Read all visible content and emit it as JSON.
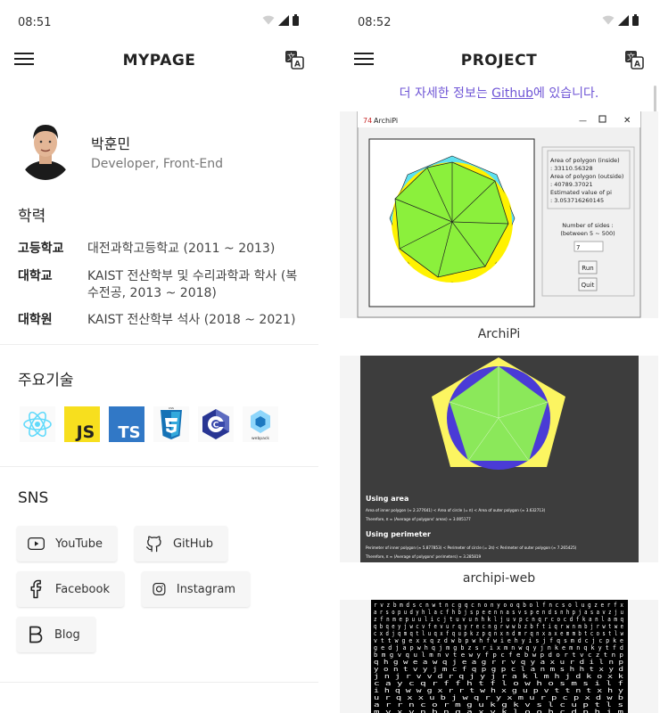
{
  "left": {
    "status_time": "08:51",
    "appbar_title": "MYPAGE",
    "profile": {
      "name": "박훈민",
      "role": "Developer, Front-End"
    },
    "education": {
      "title": "학력",
      "rows": [
        {
          "label": "고등학교",
          "value": "대전과학고등학교 (2011 ~ 2013)"
        },
        {
          "label": "대학교",
          "value": "KAIST 전산학부 및 수리과학과 학사 (복수전공, 2013 ~ 2018)"
        },
        {
          "label": "대학원",
          "value": "KAIST 전산학부 석사 (2018 ~ 2021)"
        }
      ]
    },
    "skills": {
      "title": "주요기술",
      "items": [
        "react-icon",
        "javascript-icon",
        "typescript-icon",
        "css3-icon",
        "c-icon",
        "webpack-icon"
      ],
      "js_label": "JS",
      "ts_label": "TS",
      "css_label": "CSS",
      "c_label": "C",
      "webpack_label": "webpack"
    },
    "sns": {
      "title": "SNS",
      "buttons": {
        "youtube": "YouTube",
        "github": "GitHub",
        "facebook": "Facebook",
        "instagram": "Instagram",
        "blog": "Blog"
      }
    }
  },
  "right": {
    "status_time": "08:52",
    "appbar_title": "PROJECT",
    "info_prefix": "더 자세한 정보는 ",
    "info_link": "Github",
    "info_suffix": "에 있습니다.",
    "projects": [
      {
        "caption": "ArchiPi",
        "window_title": "ArchiPi",
        "panel_lines": [
          "Area of polygon (inside)",
          ": 33110.56328",
          "Area of polygon (outside)",
          ": 40789.37021",
          "Estimated value of pi",
          ": 3.053716260145"
        ],
        "sides_label": "Number of sides :",
        "sides_range": "(between 5 ~ 500)",
        "sides_value": "7",
        "run_label": "Run",
        "quit_label": "Quit"
      },
      {
        "caption": "archipi-web",
        "area_heading": "Using area",
        "area_line1": "Area of inner polygon (≈ 2.377641) < Area of circle (= π) < Area of outer polygon (≈ 3.632713)",
        "area_line2": "Therefore, π ≈ (Average of polygons' areas) ≈ 3.005177",
        "perim_heading": "Using perimeter",
        "perim_line1": "Perimeter of inner polygon (≈ 5.877853) < Perimeter of circle (= 2π) < Perimeter of outer polygon (≈ 7.265425)",
        "perim_line2": "Therefore, π ≈ (Average of polygons' perimeters) ≈ 3.285819"
      },
      {
        "caption": "",
        "matrix_lines": [
          "r v z b m d s c n w t n c g q c n o n y o o q b o l f n c s o l u g z e r f x",
          "a r s o p u d y h l a c f h b j s p e e n n a s v s p e n d s n h p j a s a v z j u",
          "z f n m e p u u l i c j t u v u n h k l j u v p c n q r c o c d f k a n l a m q",
          "q b q e y j w c v f e v u r q y r e c n g r w w b z b f t i q r w n m b j r w t w e",
          "c x d j q m q t l u q x f q u p k z p q n x n d m r q n x a x e m m b t c o s t l w",
          "v t t w g e x x q z d w b p w h f w i e h y i s j f q s m d c   j c p   k e",
          "g e d j a p w h q j m g b z s r i x m n w q y j n k e m n q k y           t f d",
          "b m g v q u l m n v t e w y f p c f e b w p d o r t v c z               t n p",
          "q h g w e a w q j e a g r r v q y a x u r d i                             l n p",
          "y o n t v y j m c f q p g p c l a n m s h h t                             x y d",
          "j n j r v v d r q j y j r a k l m h j d k                                 o x k",
          "c a y c q r f f h t f l o w h o s m                                       s i l f",
          "i h q w w g x r r t w h x g u p v t                                 t n t x h y",
          "u r q x x u b j w q r y x m u r p                                   c p x d w b",
          "a r r n c o r m g u k g k v s l                                     c u p t l s",
          "m y x v n b n q a x y k l o o                                       h c d p h j m"
        ]
      }
    ]
  }
}
